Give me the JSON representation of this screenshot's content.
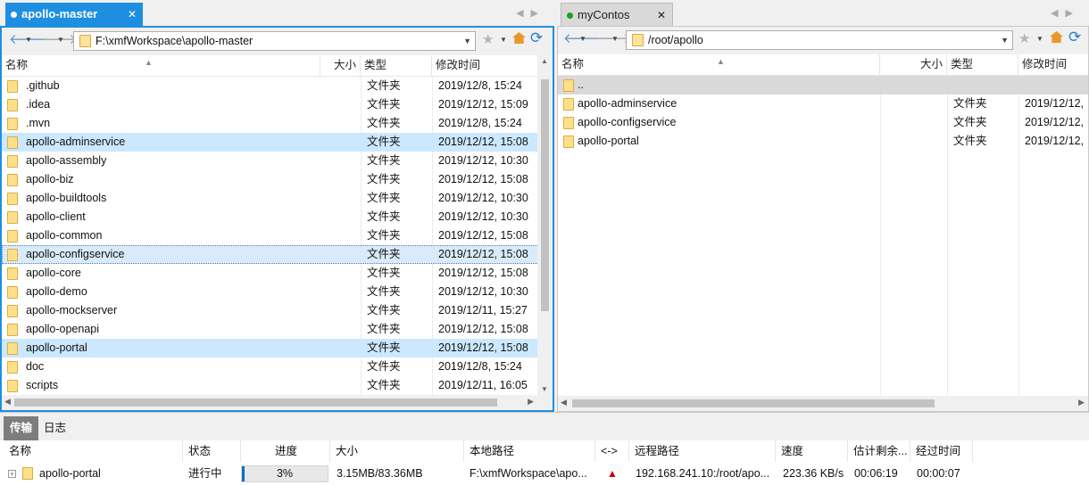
{
  "left": {
    "tab_title": "apollo-master",
    "tab_dot_color": "#ffffff",
    "path": "F:\\xmfWorkspace\\apollo-master",
    "columns": [
      "名称",
      "大小",
      "类型",
      "修改时间"
    ],
    "rows": [
      {
        "name": ".github",
        "size": "",
        "type": "文件夹",
        "modified": "2019/12/8, 15:24",
        "state": ""
      },
      {
        "name": ".idea",
        "size": "",
        "type": "文件夹",
        "modified": "2019/12/12, 15:09",
        "state": ""
      },
      {
        "name": ".mvn",
        "size": "",
        "type": "文件夹",
        "modified": "2019/12/8, 15:24",
        "state": ""
      },
      {
        "name": "apollo-adminservice",
        "size": "",
        "type": "文件夹",
        "modified": "2019/12/12, 15:08",
        "state": "selected"
      },
      {
        "name": "apollo-assembly",
        "size": "",
        "type": "文件夹",
        "modified": "2019/12/12, 10:30",
        "state": ""
      },
      {
        "name": "apollo-biz",
        "size": "",
        "type": "文件夹",
        "modified": "2019/12/12, 15:08",
        "state": ""
      },
      {
        "name": "apollo-buildtools",
        "size": "",
        "type": "文件夹",
        "modified": "2019/12/12, 10:30",
        "state": ""
      },
      {
        "name": "apollo-client",
        "size": "",
        "type": "文件夹",
        "modified": "2019/12/12, 10:30",
        "state": ""
      },
      {
        "name": "apollo-common",
        "size": "",
        "type": "文件夹",
        "modified": "2019/12/12, 15:08",
        "state": ""
      },
      {
        "name": "apollo-configservice",
        "size": "",
        "type": "文件夹",
        "modified": "2019/12/12, 15:08",
        "state": "focused"
      },
      {
        "name": "apollo-core",
        "size": "",
        "type": "文件夹",
        "modified": "2019/12/12, 15:08",
        "state": ""
      },
      {
        "name": "apollo-demo",
        "size": "",
        "type": "文件夹",
        "modified": "2019/12/12, 10:30",
        "state": ""
      },
      {
        "name": "apollo-mockserver",
        "size": "",
        "type": "文件夹",
        "modified": "2019/12/11, 15:27",
        "state": ""
      },
      {
        "name": "apollo-openapi",
        "size": "",
        "type": "文件夹",
        "modified": "2019/12/12, 15:08",
        "state": ""
      },
      {
        "name": "apollo-portal",
        "size": "",
        "type": "文件夹",
        "modified": "2019/12/12, 15:08",
        "state": "selected"
      },
      {
        "name": "doc",
        "size": "",
        "type": "文件夹",
        "modified": "2019/12/8, 15:24",
        "state": ""
      },
      {
        "name": "scripts",
        "size": "",
        "type": "文件夹",
        "modified": "2019/12/11, 16:05",
        "state": ""
      }
    ]
  },
  "right": {
    "tab_title": "myContos",
    "tab_dot_color": "#1aa31a",
    "path": "/root/apollo",
    "columns": [
      "名称",
      "大小",
      "类型",
      "修改时间"
    ],
    "rows": [
      {
        "name": "..",
        "size": "",
        "type": "",
        "modified": "",
        "state": "parent"
      },
      {
        "name": "apollo-adminservice",
        "size": "",
        "type": "文件夹",
        "modified": "2019/12/12,",
        "state": ""
      },
      {
        "name": "apollo-configservice",
        "size": "",
        "type": "文件夹",
        "modified": "2019/12/12,",
        "state": ""
      },
      {
        "name": "apollo-portal",
        "size": "",
        "type": "文件夹",
        "modified": "2019/12/12,",
        "state": ""
      }
    ]
  },
  "transfer": {
    "tabs": [
      "传输",
      "日志"
    ],
    "columns": [
      "名称",
      "状态",
      "进度",
      "大小",
      "本地路径",
      "<->",
      "远程路径",
      "速度",
      "估计剩余...",
      "经过时间"
    ],
    "items": [
      {
        "name": "apollo-portal",
        "status": "进行中",
        "progress_percent": 3,
        "progress_label": "3%",
        "size": "3.15MB/83.36MB",
        "local_path": "F:\\xmfWorkspace\\apo...",
        "direction_icon": "upload-arrow-icon",
        "remote_path": "192.168.241.10:/root/apo...",
        "speed": "223.36 KB/s",
        "remaining": "00:06:19",
        "elapsed": "00:00:07"
      }
    ]
  },
  "colors": {
    "accent": "#1e8fe0",
    "selection": "#cce8ff",
    "progress": "#0b6fc6",
    "folder": "#ffe08a",
    "upload_arrow": "#d00000"
  }
}
